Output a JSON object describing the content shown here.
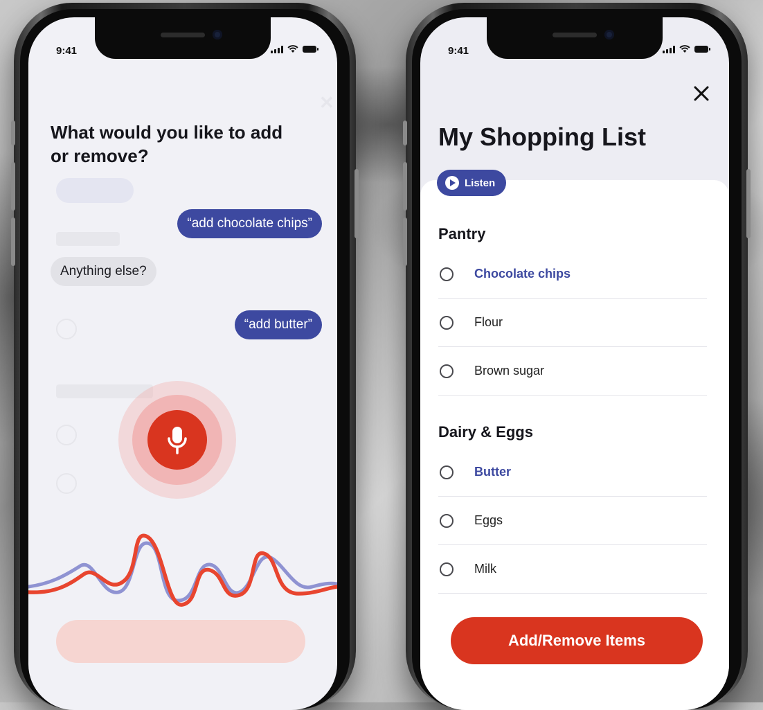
{
  "status_bar": {
    "time": "9:41"
  },
  "voice_screen": {
    "question": "What would you like to add or remove?",
    "messages": [
      {
        "from": "user",
        "text": "“add chocolate chips”"
      },
      {
        "from": "bot",
        "text": "Anything else?"
      },
      {
        "from": "user",
        "text": "“add butter”"
      }
    ],
    "mic_icon": "microphone-icon",
    "colors": {
      "mic": "#d9351f",
      "user_bubble": "#3d49a0",
      "bot_bubble": "#e2e2e7",
      "wave_red": "#e8452f",
      "wave_blue": "#8f93d2"
    }
  },
  "list_screen": {
    "title": "My Shopping List",
    "listen_label": "Listen",
    "close_icon": "close-icon",
    "sections": [
      {
        "title": "Pantry",
        "items": [
          {
            "label": "Chocolate chips",
            "highlighted": true
          },
          {
            "label": "Flour",
            "highlighted": false
          },
          {
            "label": "Brown sugar",
            "highlighted": false
          }
        ]
      },
      {
        "title": "Dairy & Eggs",
        "items": [
          {
            "label": "Butter",
            "highlighted": true
          },
          {
            "label": "Eggs",
            "highlighted": false
          },
          {
            "label": "Milk",
            "highlighted": false
          }
        ]
      }
    ],
    "action_button": "Add/Remove Items",
    "colors": {
      "accent": "#3d49a0",
      "action": "#d9351f"
    }
  }
}
